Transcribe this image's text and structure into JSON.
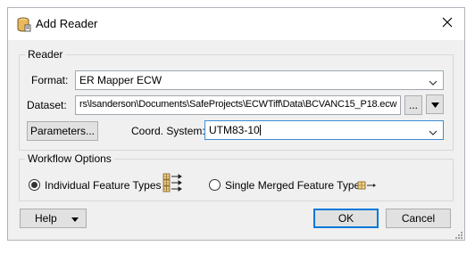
{
  "window": {
    "title": "Add Reader",
    "title_icon": "reader-cylinder-icon",
    "close_icon": "close-icon"
  },
  "reader_group": {
    "label": "Reader",
    "format_label": "Format:",
    "format_value": "ER Mapper ECW",
    "dataset_label": "Dataset:",
    "dataset_value": "rs\\lsanderson\\Documents\\SafeProjects\\ECWTiff\\Data\\BCVANC15_P18.ecw",
    "browse_label": "...",
    "parameters_label": "Parameters...",
    "coord_label": "Coord. System:",
    "coord_value": "UTM83-10"
  },
  "workflow_group": {
    "label": "Workflow Options",
    "individual_label": "Individual Feature Types",
    "individual_selected": true,
    "individual_icon": "multiple-feature-types-icon",
    "merged_label": "Single Merged Feature Type",
    "merged_selected": false,
    "merged_icon": "single-feature-type-icon"
  },
  "footer": {
    "help_label": "Help",
    "ok_label": "OK",
    "cancel_label": "Cancel"
  },
  "colors": {
    "dialog_bg": "#f0f0f0",
    "focus_blue": "#0078d7",
    "icon_gold": "#c89a3c"
  }
}
